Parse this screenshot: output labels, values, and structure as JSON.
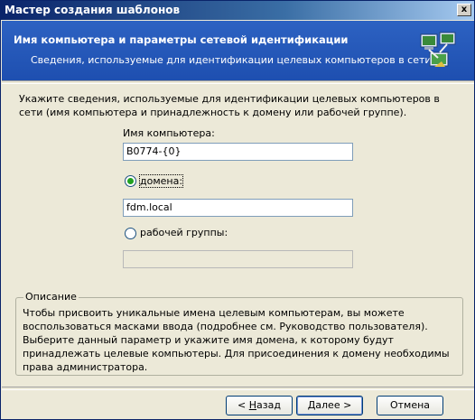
{
  "window": {
    "title": "Мастер создания шаблонов",
    "close_glyph": "x"
  },
  "header": {
    "title": "Имя компьютера и параметры сетевой идентификации",
    "subtitle": "Сведения, используемые для идентификации целевых компьютеров в сети",
    "icon": "network-computers-icon"
  },
  "intro": "Укажите сведения, используемые для идентификации целевых компьютеров в сети (имя компьютера и принадлежность к домену или рабочей группе).",
  "computer_name": {
    "label": "Имя компьютера:",
    "value": "B0774-{0}"
  },
  "domain": {
    "label": "домена:",
    "selected": true,
    "value": "fdm.local"
  },
  "workgroup": {
    "label": "рабочей группы:",
    "selected": false,
    "value": ""
  },
  "description": {
    "legend": "Описание",
    "text": "Чтобы присвоить уникальные имена целевым компьютерам, вы можете воспользоваться масками ввода (подробнее см. Руководство пользователя). Выберите данный параметр и укажите имя домена, к которому будут принадлежать целевые компьютеры. Для присоединения к домену необходимы права администратора."
  },
  "buttons": {
    "back": {
      "prefix": "< ",
      "mnemonic": "Н",
      "rest": "азад"
    },
    "next": {
      "mnemonic": "Д",
      "rest": "алее >"
    },
    "cancel": {
      "label": "Отмена"
    }
  }
}
